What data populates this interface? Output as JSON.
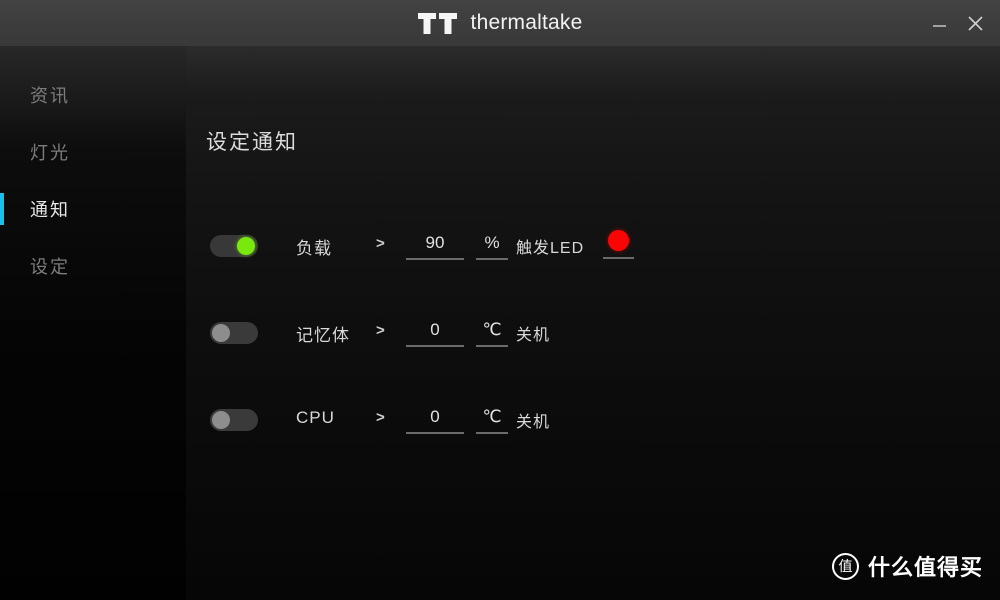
{
  "window": {
    "brand_name": "thermaltake",
    "brand_mark_icon": "tt-logo-icon",
    "minimize_label": "—",
    "close_label": "✕"
  },
  "sidebar": {
    "items": [
      {
        "label": "资讯",
        "active": false
      },
      {
        "label": "灯光",
        "active": false
      },
      {
        "label": "通知",
        "active": true
      },
      {
        "label": "设定",
        "active": false
      }
    ],
    "active_indicator_color": "#12c3f0"
  },
  "main": {
    "page_title": "设定通知",
    "rows": [
      {
        "name": "load",
        "toggle_on": true,
        "label": "负载",
        "operator": ">",
        "value": "90",
        "unit": "%",
        "action": "触发LED",
        "led_color": "#fa0505"
      },
      {
        "name": "memory",
        "toggle_on": false,
        "label": "记忆体",
        "operator": ">",
        "value": "0",
        "unit": "℃",
        "action": "关机",
        "led_color": null
      },
      {
        "name": "cpu",
        "toggle_on": false,
        "label": "CPU",
        "operator": ">",
        "value": "0",
        "unit": "℃",
        "action": "关机",
        "led_color": null
      }
    ]
  },
  "watermark": {
    "badge": "值",
    "text": "什么值得买"
  }
}
